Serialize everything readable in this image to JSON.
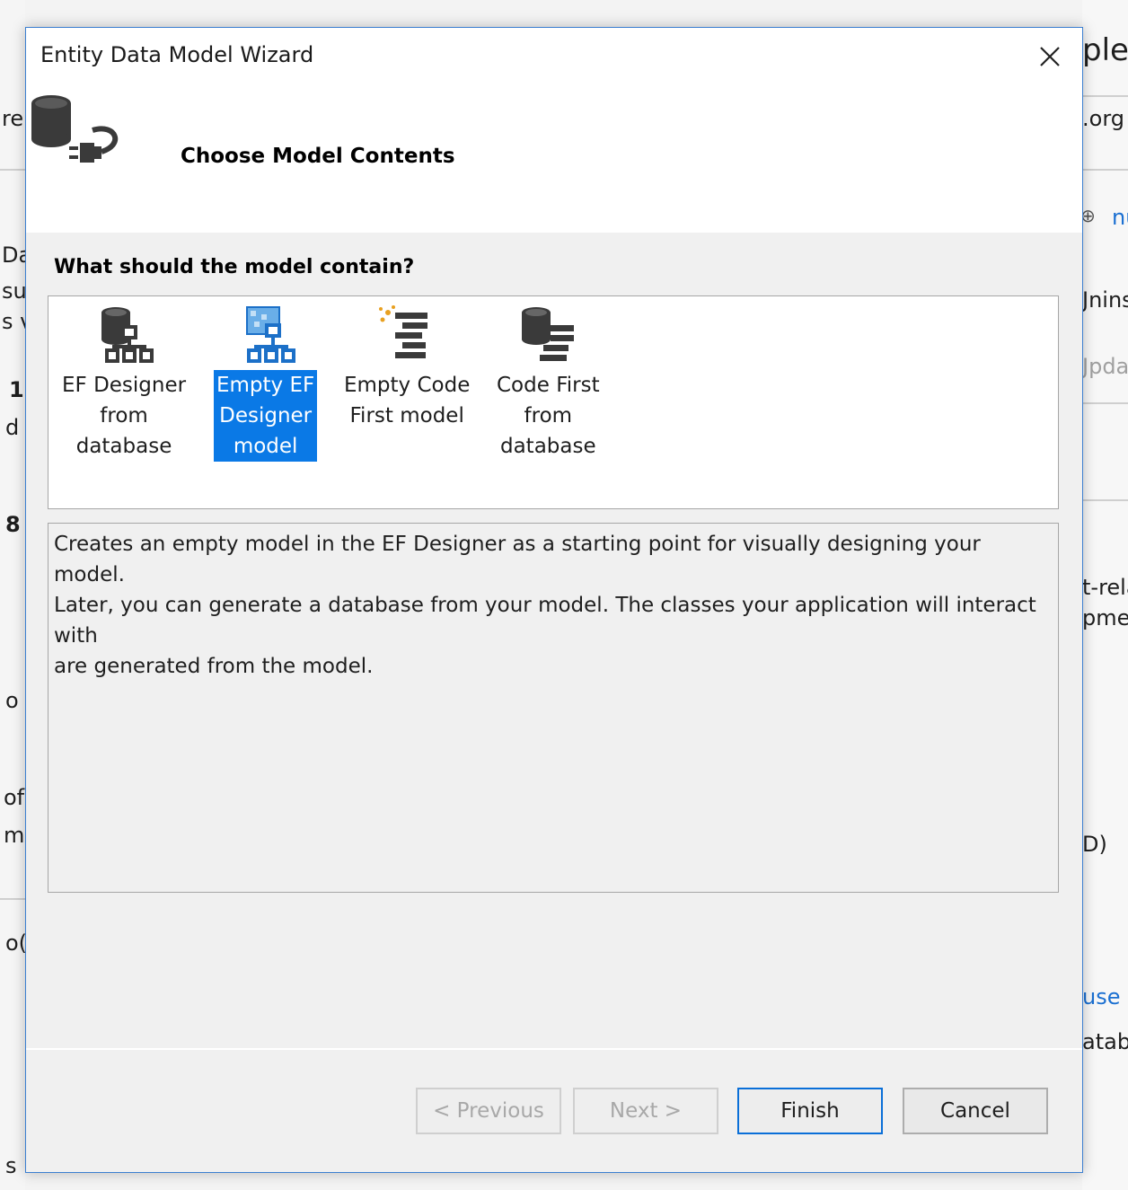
{
  "background": {
    "fragments": [
      {
        "text": "ple",
        "style": "big"
      },
      {
        "text": ".org"
      },
      {
        "text": "nu",
        "style": "link"
      },
      {
        "text": "Jnins"
      },
      {
        "text": "Jpda",
        "style": "dim"
      },
      {
        "text": "t-rela"
      },
      {
        "text": "pmer"
      },
      {
        "text": "D)"
      },
      {
        "text": "use",
        "style": "link"
      },
      {
        "text": "atab"
      },
      {
        "text": "re"
      },
      {
        "text": "Da"
      },
      {
        "text": "su"
      },
      {
        "text": "s v"
      },
      {
        "text": "1"
      },
      {
        "text": "d"
      },
      {
        "text": "8"
      },
      {
        "text": "o"
      },
      {
        "text": "of"
      },
      {
        "text": "m"
      },
      {
        "text": "o("
      },
      {
        "text": "s"
      }
    ]
  },
  "dialog": {
    "title": "Entity Data Model Wizard",
    "subtitle": "Choose Model Contents",
    "question": "What should the model contain?",
    "options": [
      {
        "label_lines": [
          "EF Designer",
          "from",
          "database"
        ],
        "icon": "database-hierarchy-icon",
        "selected": false
      },
      {
        "label_lines": [
          "Empty EF",
          "Designer",
          "model"
        ],
        "icon": "empty-designer-hierarchy-icon",
        "selected": true
      },
      {
        "label_lines": [
          "Empty Code",
          "First model"
        ],
        "icon": "code-first-sparkle-icon",
        "selected": false
      },
      {
        "label_lines": [
          "Code First",
          "from",
          "database"
        ],
        "icon": "database-code-icon",
        "selected": false
      }
    ],
    "description_lines": [
      "Creates an empty model in the EF Designer as a starting point for visually designing your model.",
      "Later, you can generate a database from your model. The classes your application will interact with",
      "are generated from the model."
    ],
    "buttons": {
      "previous": "< Previous",
      "next": "Next >",
      "finish": "Finish",
      "cancel": "Cancel"
    },
    "colors": {
      "selection": "#0a79e6",
      "accent_border": "#0a6fd8"
    }
  }
}
